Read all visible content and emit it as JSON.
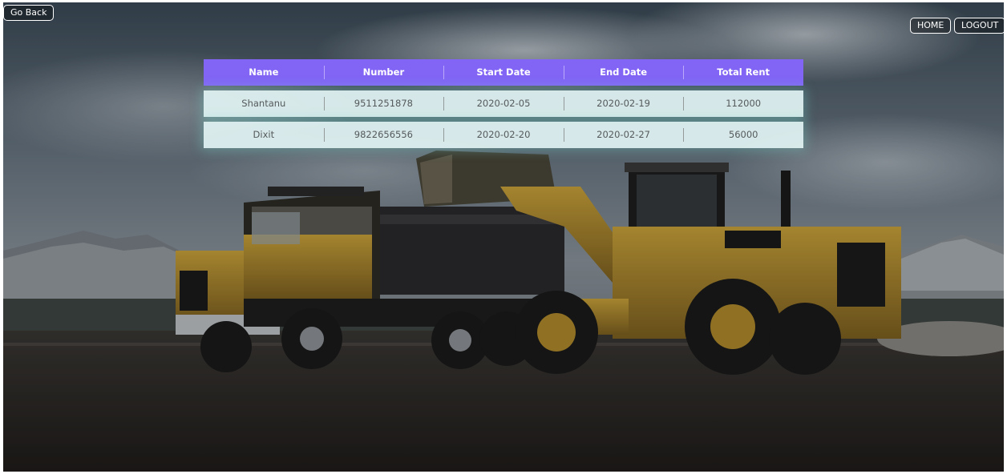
{
  "nav": {
    "go_back_label": "Go Back",
    "home_label": "HOME",
    "logout_label": "LOGOUT"
  },
  "rent_table": {
    "columns": [
      "Name",
      "Number",
      "Start Date",
      "End Date",
      "Total Rent"
    ],
    "rows": [
      [
        "Shantanu",
        "9511251878",
        "2020-02-05",
        "2020-02-19",
        "112000"
      ],
      [
        "Dixit",
        "9822656556",
        "2020-02-20",
        "2020-02-27",
        "56000"
      ]
    ]
  },
  "colors": {
    "header_bg": "#8265f5",
    "row_bg": "#e2f4f4"
  }
}
